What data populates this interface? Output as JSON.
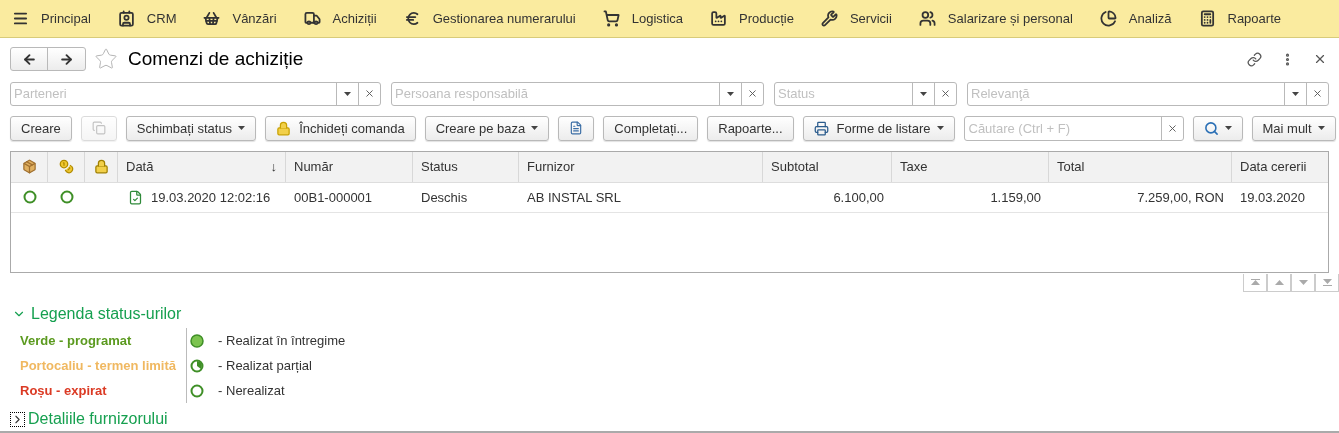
{
  "menu": [
    {
      "label": "Principal"
    },
    {
      "label": "CRM"
    },
    {
      "label": "Vânzări"
    },
    {
      "label": "Achiziții"
    },
    {
      "label": "Gestionarea numerarului"
    },
    {
      "label": "Logistica"
    },
    {
      "label": "Producție"
    },
    {
      "label": "Servicii"
    },
    {
      "label": "Salarizare și personal"
    },
    {
      "label": "Analiză"
    },
    {
      "label": "Rapoarte"
    }
  ],
  "title": "Comenzi de achiziție",
  "favorite": false,
  "filters": [
    {
      "placeholder": "Parteneri"
    },
    {
      "placeholder": "Persoana responsabilă"
    },
    {
      "placeholder": "Status"
    },
    {
      "placeholder": "Relevanţă"
    }
  ],
  "toolbar": [
    {
      "kind": "text",
      "label": "Creare",
      "dropdown": false
    },
    {
      "kind": "copy",
      "disabled": true
    },
    {
      "kind": "text",
      "label": "Schimbați status",
      "dropdown": true
    },
    {
      "kind": "lock",
      "label": "Închideți comanda",
      "dropdown": false
    },
    {
      "kind": "text",
      "label": "Creare pe baza",
      "dropdown": true
    },
    {
      "kind": "report",
      "disabled": false
    },
    {
      "kind": "text",
      "label": "Completați...",
      "dropdown": false
    },
    {
      "kind": "text",
      "label": "Rapoarte...",
      "dropdown": false
    },
    {
      "kind": "print",
      "label": "Forme de listare",
      "dropdown": true
    },
    {
      "kind": "search",
      "placeholder": "Căutare (Ctrl + F)"
    },
    {
      "kind": "find",
      "dropdown": true
    },
    {
      "kind": "text",
      "label": "Mai mult",
      "dropdown": true
    }
  ],
  "table": {
    "columns": [
      {
        "kind": "box"
      },
      {
        "kind": "coins"
      },
      {
        "kind": "lock"
      },
      {
        "kind": "text",
        "label": "Dată",
        "sort_mark": "↓"
      },
      {
        "kind": "text",
        "label": "Număr"
      },
      {
        "kind": "text",
        "label": "Status"
      },
      {
        "kind": "text",
        "label": "Furnizor"
      },
      {
        "kind": "text",
        "label": "Subtotal"
      },
      {
        "kind": "text",
        "label": "Taxe"
      },
      {
        "kind": "text",
        "label": "Total"
      },
      {
        "kind": "text",
        "label": "Data cererii"
      }
    ],
    "rows": [
      {
        "cells": [
          {
            "kind": "none"
          },
          {
            "kind": "none"
          },
          {
            "kind": "open"
          },
          {
            "text": "19.03.2020 12:02:16",
            "posted": true
          },
          {
            "text": "00B1-000001"
          },
          {
            "text": "Deschis"
          },
          {
            "text": "AB INSTAL SRL"
          },
          {
            "text": "6.100,00"
          },
          {
            "text": "1.159,00"
          },
          {
            "text": "7.259,00, RON"
          },
          {
            "text": "19.03.2020"
          }
        ]
      }
    ]
  },
  "legend": {
    "title": "Legenda status-urilor",
    "expanded": true,
    "deadlines": [
      {
        "label": "Verde - programat",
        "color": "#5b9a1f"
      },
      {
        "label": "Portocaliu - termen limită",
        "color": "#f0b860"
      },
      {
        "label": "Roșu - expirat",
        "color": "#db3a24"
      }
    ],
    "states": [
      {
        "kind": "full",
        "label": "- Realizat în întregime"
      },
      {
        "kind": "partial",
        "label": "- Realizat parțial"
      },
      {
        "kind": "none",
        "label": "- Nerealizat"
      }
    ]
  },
  "details": {
    "title": "Detaliile furnizorului",
    "expanded": false
  }
}
